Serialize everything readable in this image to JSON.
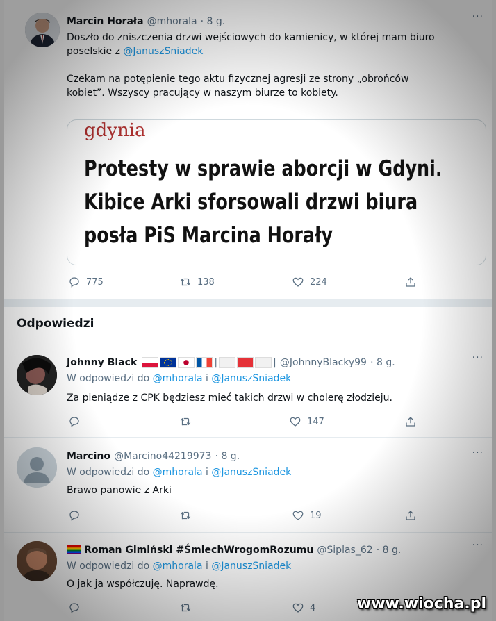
{
  "main_tweet": {
    "name": "Marcin Horała",
    "handle": "@mhorala",
    "time": "· 8 g.",
    "more": "···",
    "text1_a": "Doszło do zniszczenia drzwi wejściowych do kamienicy, w której mam biuro",
    "text1_b": "poselskie z ",
    "mention": "@JanuszSniadek",
    "text2_a": "Czekam na potępienie tego aktu fizycznej agresji ze strony „obrońców",
    "text2_b": "kobiet”. Wszyscy pracujący w naszym biurze to kobiety.",
    "card": {
      "brand": "gdynia",
      "headline_1": "Protesty w sprawie aborcji w Gdyni.",
      "headline_2": "Kibice Arki sforsowali drzwi biura",
      "headline_3": "posła PiS Marcina Horały"
    },
    "replies": "775",
    "retweets": "138",
    "likes": "224"
  },
  "section_title": "Odpowiedzi",
  "replies": [
    {
      "name": "Johnny Black",
      "handle": "@JohnnyBlacky99",
      "time": "· 8 g.",
      "sep": "|",
      "reply_to_prefix": "W odpowiedzi do ",
      "reply_to_1": "@mhorala",
      "reply_to_and": " i ",
      "reply_to_2": "@JanuszSniadek",
      "text": "Za pieniądze z CPK będziesz mieć takich drzwi w cholerę złodzieju.",
      "replies": "",
      "retweets": "",
      "likes": "147"
    },
    {
      "name": "Marcino",
      "handle": "@Marcino44219973",
      "time": "· 8 g.",
      "reply_to_prefix": "W odpowiedzi do ",
      "reply_to_1": "@mhorala",
      "reply_to_and": " i ",
      "reply_to_2": "@JanuszSniadek",
      "text": "Brawo panowie z Arki",
      "replies": "",
      "retweets": "",
      "likes": "19"
    },
    {
      "name": "Roman Gimiński #ŚmiechWrogomRozumu",
      "handle": "@Siplas_62",
      "time": "· 8 g.",
      "reply_to_prefix": "W odpowiedzi do ",
      "reply_to_1": "@mhorala",
      "reply_to_and": " i ",
      "reply_to_2": "@JanuszSniadek",
      "text": "O jak ja współczuję. Naprawdę.",
      "replies": "",
      "retweets": "",
      "likes": "4"
    }
  ],
  "watermark": "www.wiocha.pl",
  "colors": {
    "link": "#1b95e0",
    "muted": "#5b7083",
    "brand": "#b0302f"
  }
}
